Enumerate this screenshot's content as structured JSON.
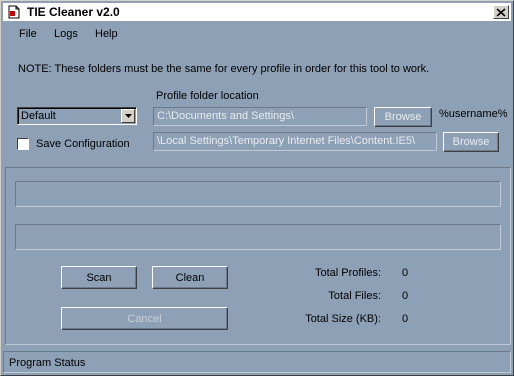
{
  "window": {
    "title": "TIE Cleaner v2.0",
    "close_glyph": "✕"
  },
  "menu": {
    "items": [
      "File",
      "Logs",
      "Help"
    ]
  },
  "note": "NOTE: These folders must be the same for every profile in order for this tool to work.",
  "profile": {
    "selected": "Default",
    "location_label": "Profile folder location",
    "location_value": "C:\\Documents and Settings\\",
    "browse_label": "Browse",
    "username_label": "%username%",
    "subpath_value": "\\Local Settings\\Temporary Internet Files\\Content.IE5\\",
    "browse2_label": "Browse"
  },
  "save_config": {
    "label": "Save Configuration",
    "checked": false
  },
  "actions": {
    "scan_label": "Scan",
    "clean_label": "Clean",
    "cancel_label": "Cancel"
  },
  "stats": {
    "total_profiles_label": "Total Profiles:",
    "total_profiles_value": "0",
    "total_files_label": "Total Files:",
    "total_files_value": "0",
    "total_size_label": "Total Size (KB):",
    "total_size_value": "0"
  },
  "status": {
    "text": "Program Status"
  },
  "icons": {
    "app": "app-document-icon",
    "close": "close-icon",
    "combo": "chevron-down-icon"
  }
}
